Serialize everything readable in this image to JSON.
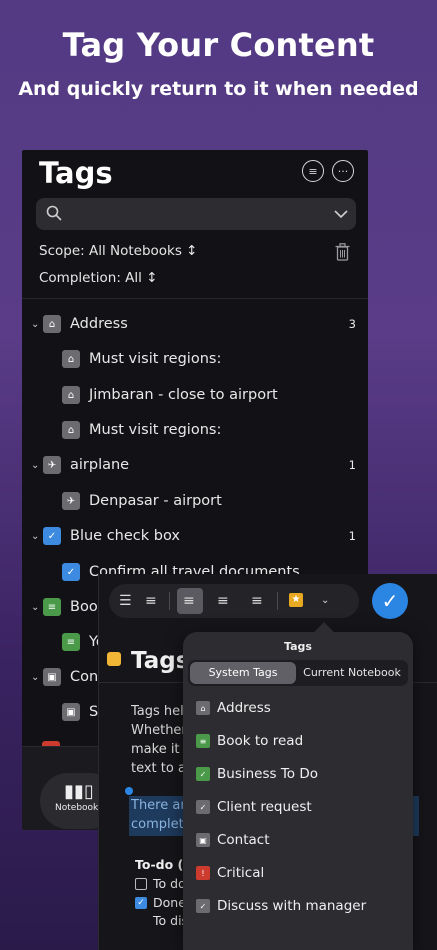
{
  "hero": {
    "title": "Tag Your Content",
    "subtitle": "And quickly return to it when needed"
  },
  "panel": {
    "title": "Tags",
    "filter_icon": "filter-circle-icon",
    "more_icon": "ellipsis-circle-icon",
    "scope_label": "Scope: All Notebooks ↕",
    "completion_label": "Completion: All ↕",
    "rows": [
      {
        "label": "Address",
        "count": "3",
        "icon": "house-icon"
      },
      {
        "label": "Must visit regions:",
        "icon": "house-icon"
      },
      {
        "label": "Jimbaran - close to airport",
        "icon": "house-icon"
      },
      {
        "label": "Must visit regions:",
        "icon": "house-icon"
      },
      {
        "label": "airplane",
        "count": "1",
        "icon": "airplane-icon"
      },
      {
        "label": "Denpasar - airport",
        "icon": "airplane-icon"
      },
      {
        "label": "Blue check box",
        "count": "1",
        "icon": "checkbox-icon"
      },
      {
        "label": "Confirm all travel documents",
        "icon": "checkbox-icon"
      },
      {
        "label": "Bool",
        "icon": "book-icon"
      },
      {
        "label": "Yo",
        "icon": "book-icon"
      },
      {
        "label": "Cont",
        "icon": "contact-icon"
      },
      {
        "label": "S",
        "icon": "contact-icon"
      }
    ],
    "notebooks_button": "Notebooks"
  },
  "editor": {
    "title": "Tags",
    "body_lines": [
      "Tags hel",
      "Whether",
      "make it e",
      "text to a"
    ],
    "highlight_lines": [
      "There ar",
      "complete"
    ],
    "todo_heading": "To-do (c",
    "todos": [
      {
        "label": "To do",
        "checked": false
      },
      {
        "label": "Done",
        "checked": true
      },
      {
        "label": "To discuss with Joe",
        "checked": false
      }
    ]
  },
  "popover": {
    "title": "Tags",
    "segments": [
      "System Tags",
      "Current Notebook"
    ],
    "items": [
      {
        "label": "Address",
        "color": "#6b6b70",
        "glyph": "⌂"
      },
      {
        "label": "Book to read",
        "color": "#4a9a4a",
        "glyph": "≡"
      },
      {
        "label": "Business To Do",
        "color": "#4a9a4a",
        "glyph": "✓"
      },
      {
        "label": "Client request",
        "color": "#6b6b70",
        "glyph": "✓"
      },
      {
        "label": "Contact",
        "color": "#6b6b70",
        "glyph": "▣"
      },
      {
        "label": "Critical",
        "color": "#cc3b2e",
        "glyph": "!"
      },
      {
        "label": "Discuss with manager",
        "color": "#6b6b70",
        "glyph": "✓"
      }
    ]
  }
}
